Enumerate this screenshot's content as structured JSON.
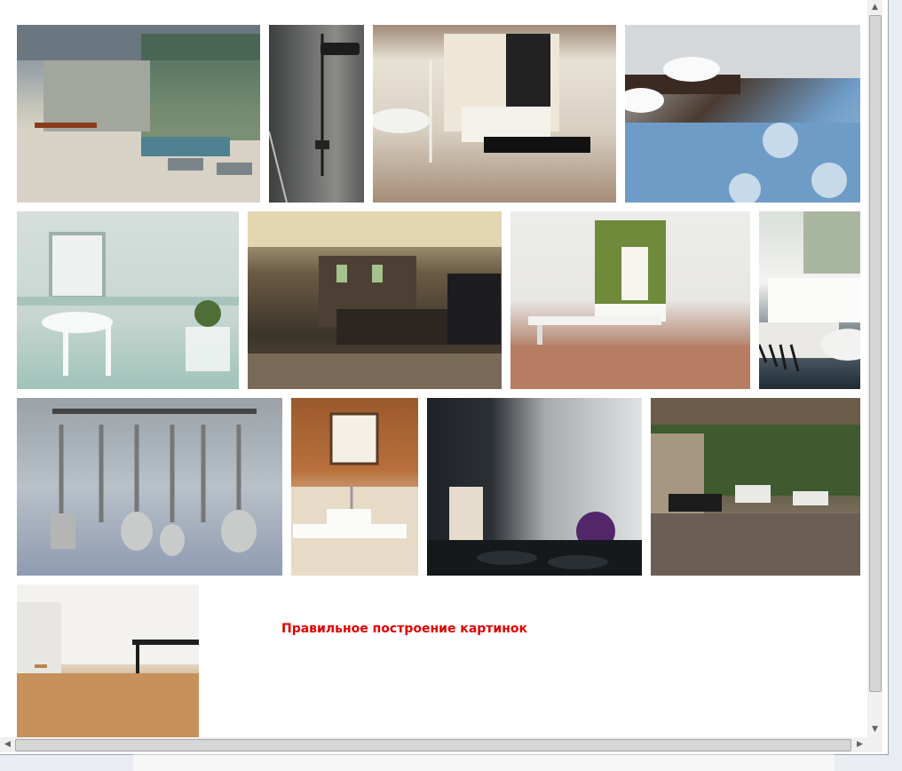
{
  "message": {
    "text": "Правильное построение картинок",
    "color": "#e00000"
  },
  "gallery": {
    "images": [
      {
        "name": "modern-villa-terrace-photo"
      },
      {
        "name": "dark-shower-tiles-photo"
      },
      {
        "name": "beige-bathroom-sinks-photo"
      },
      {
        "name": "blue-pattern-floor-bathroom-photo"
      },
      {
        "name": "mint-bathroom-washbasin-photo"
      },
      {
        "name": "brown-tile-spa-bath-photo"
      },
      {
        "name": "green-accent-living-room-photo"
      },
      {
        "name": "white-sofa-zebra-rug-photo"
      },
      {
        "name": "kitchen-utensils-hexagon-tiles-photo"
      },
      {
        "name": "orange-mosaic-washbasin-photo"
      },
      {
        "name": "kitchen-black-white-tiles-photo"
      },
      {
        "name": "open-living-space-fireplace-photo"
      },
      {
        "name": "herringbone-wood-floor-kitchen-photo"
      }
    ]
  },
  "scrollbars": {
    "up_icon": "arrow-up-icon",
    "down_icon": "arrow-down-icon",
    "left_icon": "arrow-left-icon",
    "right_icon": "arrow-right-icon"
  }
}
